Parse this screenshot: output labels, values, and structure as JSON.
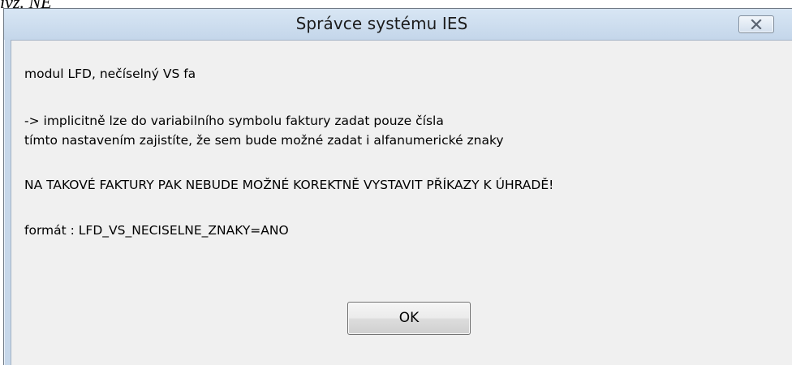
{
  "background_fragment": "ivz. NE",
  "window": {
    "title": "Správce systému IES",
    "close_icon": "close-x-icon"
  },
  "message": {
    "line1": "modul LFD, nečíselný VS fa",
    "line2": "-> implicitně lze do variabilního symbolu faktury zadat pouze čísla",
    "line3": "tímto nastavením zajistíte, že sem bude možné zadat i alfanumerické znaky",
    "line4": "NA TAKOVÉ FAKTURY PAK NEBUDE MOŽNÉ KOREKTNĚ VYSTAVIT PŘÍKAZY K ÚHRADĚ!",
    "line5": "formát : LFD_VS_NECISELNE_ZNAKY=ANO"
  },
  "buttons": {
    "ok_label": "OK"
  }
}
